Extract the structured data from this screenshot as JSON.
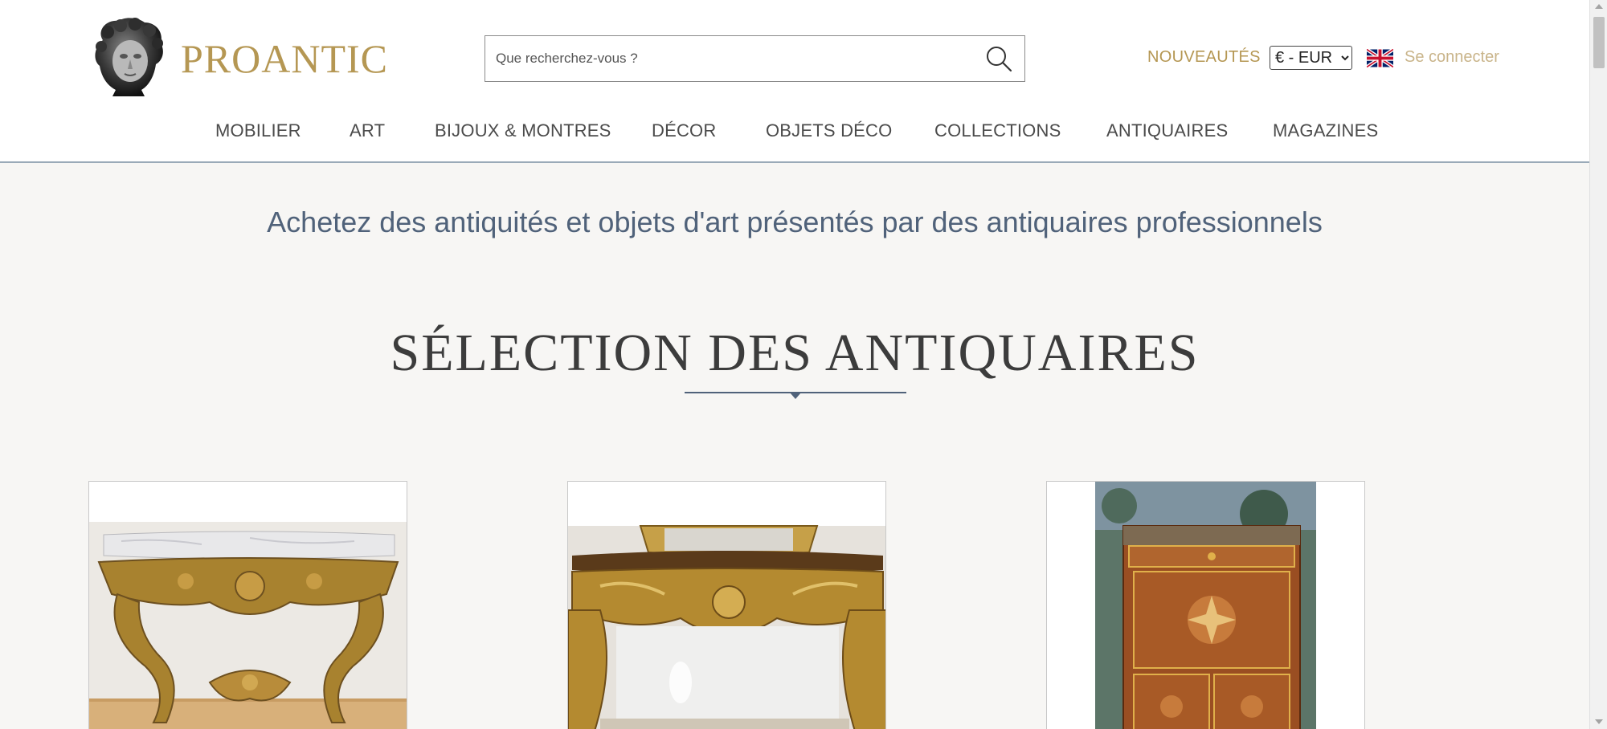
{
  "header": {
    "brand": "PROANTIC",
    "logo_icon": "bust-statue-icon",
    "search": {
      "placeholder": "Que recherchez-vous ?",
      "icon": "search-icon"
    },
    "new_label": "NOUVEAUTÉS",
    "currency": {
      "selected": "€ - EUR"
    },
    "language_icon": "uk-flag-icon",
    "login_label": "Se connecter"
  },
  "nav": {
    "items": [
      {
        "label": "MOBILIER"
      },
      {
        "label": "ART"
      },
      {
        "label": "BIJOUX & MONTRES"
      },
      {
        "label": "DÉCOR"
      },
      {
        "label": "OBJETS DÉCO"
      },
      {
        "label": "COLLECTIONS"
      },
      {
        "label": "ANTIQUAIRES"
      },
      {
        "label": "MAGAZINES"
      }
    ]
  },
  "main": {
    "tagline": "Achetez des antiquités et objets d'art présentés par des antiquaires professionnels",
    "section_title": "SÉLECTION DES ANTIQUAIRES",
    "cards": [
      {
        "image": "gilt-console-marble-top"
      },
      {
        "image": "gilt-console-mirror"
      },
      {
        "image": "marquetry-secretaire"
      }
    ]
  },
  "colors": {
    "brand_gold": "#b59753",
    "login_gold": "#c9b48a",
    "accent_blue": "#50627a",
    "page_bg": "#f7f6f4"
  }
}
